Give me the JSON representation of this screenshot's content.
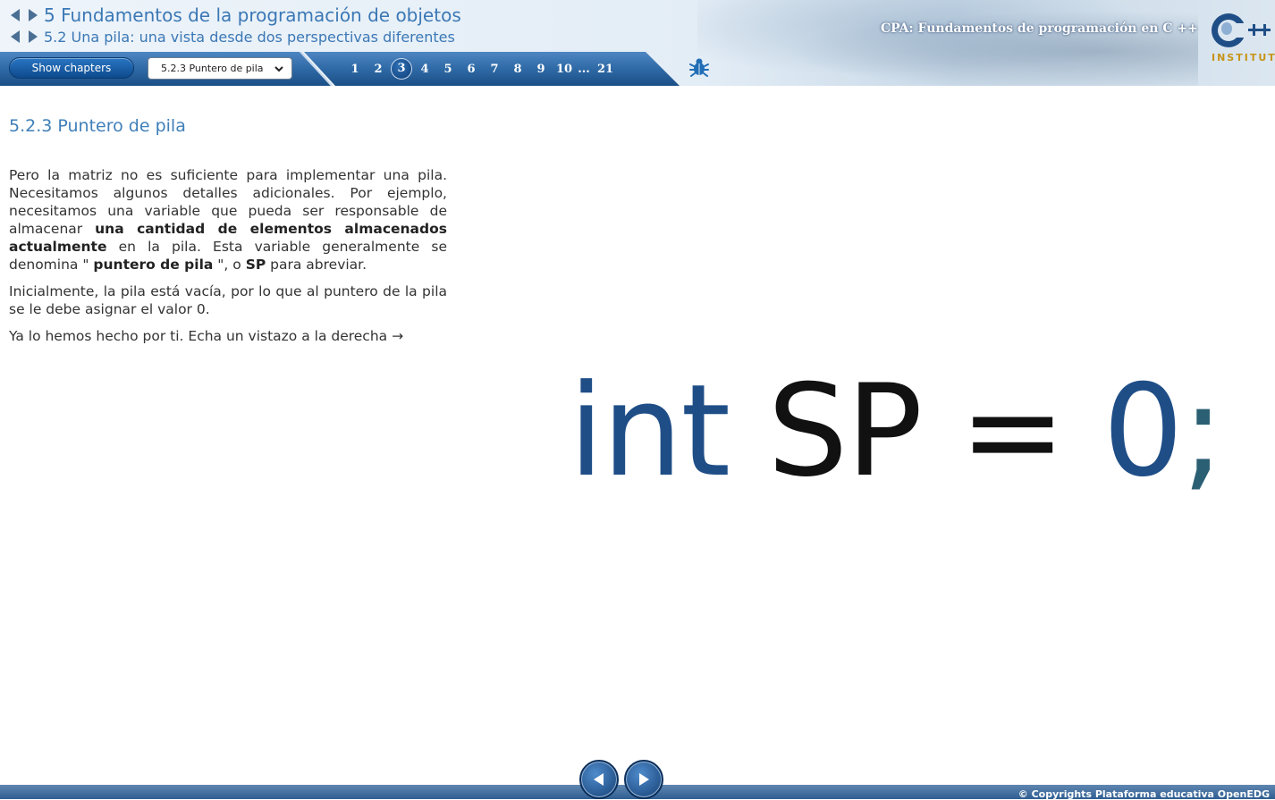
{
  "header": {
    "chapter_title": "5 Fundamentos de la programación de objetos",
    "section_title": "5.2 Una pila: una vista desde dos perspectivas diferentes",
    "course_title": "CPA: Fundamentos de programación en C ++",
    "logo_text": "INSTITUTE",
    "logo_mark": "C++"
  },
  "toolbar": {
    "show_chapters_label": "Show chapters",
    "section_select_value": "5.2.3 Puntero de pila",
    "pages": [
      "1",
      "2",
      "3",
      "4",
      "5",
      "6",
      "7",
      "8",
      "9",
      "10"
    ],
    "active_page": "3",
    "ellipsis": "...",
    "last_page": "21"
  },
  "content": {
    "title": "5.2.3 Puntero de pila",
    "p1_a": "Pero la matriz no es suficiente para implementar una pila. Necesitamos algunos detalles adicionales. Por ejemplo, necesitamos una variable que pueda ser responsable de almacenar ",
    "p1_b": "una cantidad de elementos almacenados actualmente",
    "p1_c": " en la pila. Esta variable generalmente se denomina \" ",
    "p1_d": "puntero de pila",
    "p1_e": " \", o ",
    "p1_f": "SP",
    "p1_g": " para abreviar.",
    "p2": "Inicialmente, la pila está vacía, por lo que al puntero de la pila se le debe asignar el valor 0.",
    "p3": "Ya lo hemos hecho por ti. Echa un vistazo a la derecha →"
  },
  "code": {
    "kw": "int",
    "id": "SP",
    "op": "=",
    "num": "0",
    "semi": ";"
  },
  "footer": {
    "copyright": "© Copyrights Plataforma educativa OpenEDG"
  },
  "colors": {
    "accent": "#3b78b5",
    "toolbar": "#2f6aa6",
    "code_keyword": "#1f4e87",
    "logo_gold": "#c79417"
  }
}
